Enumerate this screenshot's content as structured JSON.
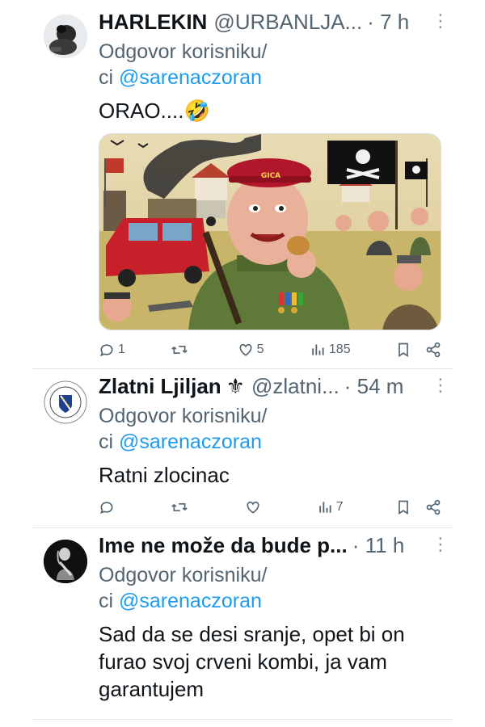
{
  "tweets": [
    {
      "name": "HARLEKIN",
      "handle": "@URBANLJA...",
      "time": "· 7 h",
      "reply_prefix": "Odgovor korisniku/",
      "reply_ci": "ci",
      "reply_mention": "@sarenaczoran",
      "text": "ORAO....🤣",
      "stats": {
        "replies": "1",
        "retweets": "",
        "likes": "5",
        "views": "185"
      }
    },
    {
      "name": "Zlatni Ljiljan",
      "name_suffix": "⚜",
      "handle": "@zlatni...",
      "time": "· 54 m",
      "reply_prefix": "Odgovor korisniku/",
      "reply_ci": "ci",
      "reply_mention": "@sarenaczoran",
      "text": "Ratni zlocinac",
      "stats": {
        "replies": "",
        "retweets": "",
        "likes": "",
        "views": "7"
      }
    },
    {
      "name": "Ime ne može da bude p...",
      "handle": "",
      "time": "· 11 h",
      "reply_prefix": "Odgovor korisniku/",
      "reply_ci": "ci",
      "reply_mention": "@sarenaczoran",
      "text_line1": "Sad da se desi sranje, opet bi on",
      "text_line2": "furao svoj crveni kombi, ja vam",
      "text_line3": "garantujem"
    }
  ],
  "image": {
    "cap_text": "GICA"
  },
  "colors": {
    "text": "#0f1419",
    "muted": "#536471",
    "link": "#1d9bf0"
  },
  "icons": [
    "reply-icon",
    "retweet-icon",
    "like-icon",
    "views-icon",
    "bookmark-icon",
    "share-icon",
    "more-icon"
  ]
}
